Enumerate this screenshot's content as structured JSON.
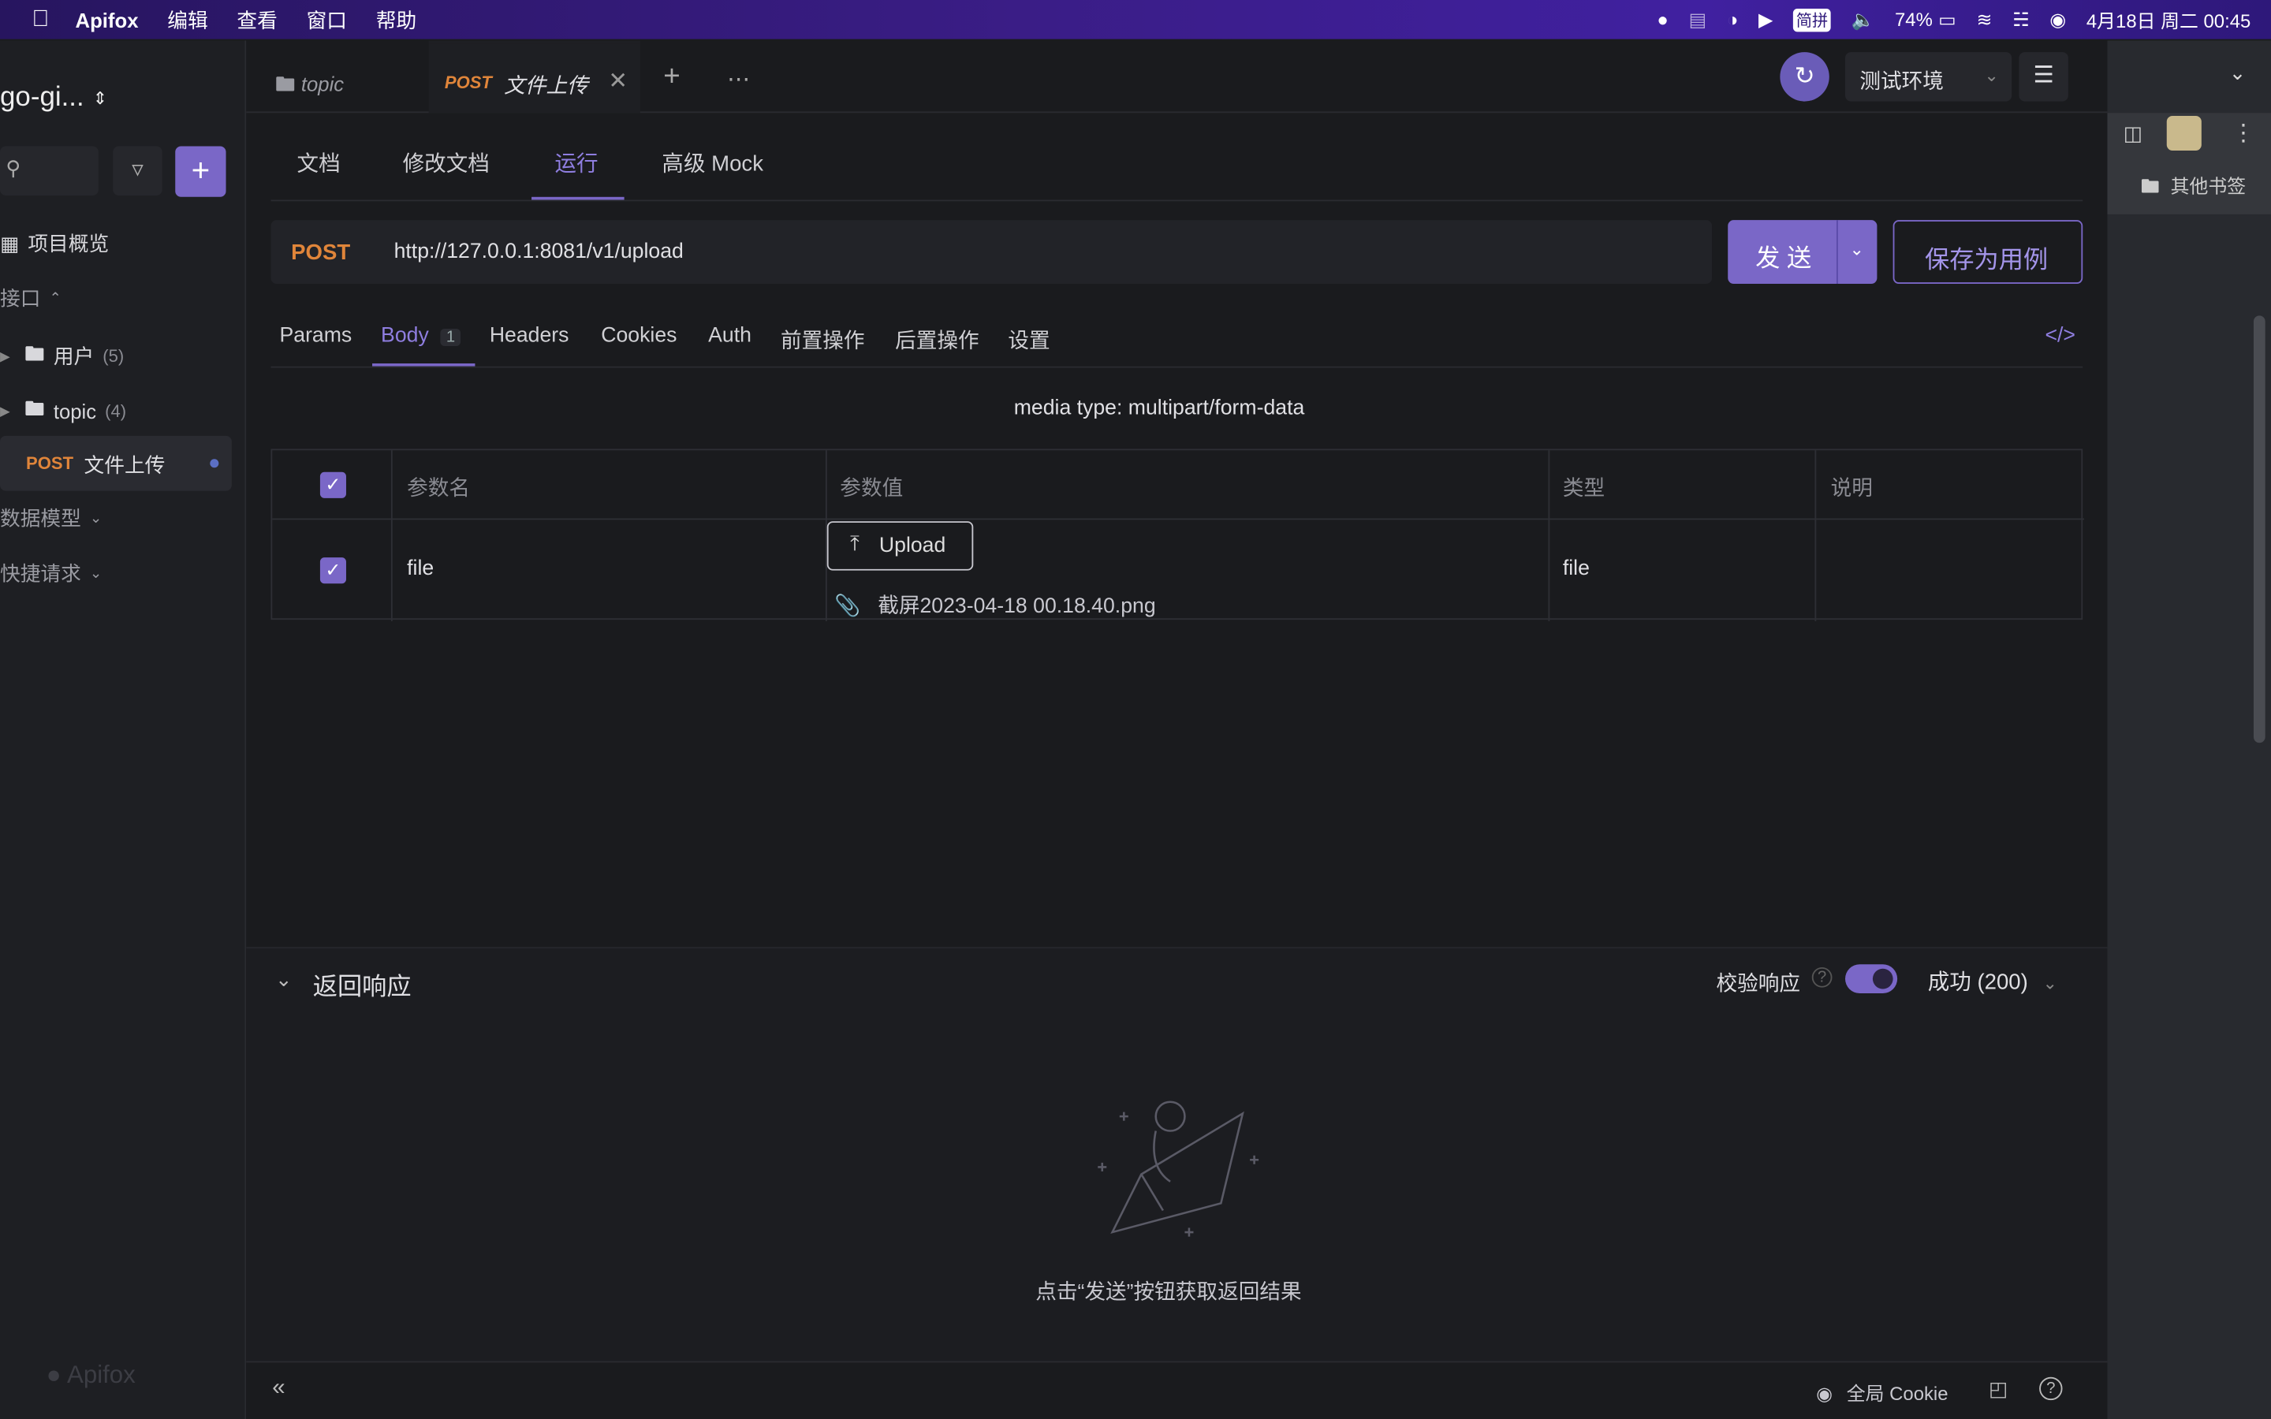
{
  "menubar": {
    "apple": "",
    "app": "Apifox",
    "items": [
      "编辑",
      "查看",
      "窗口",
      "帮助"
    ],
    "tray": {
      "ime": "简拼",
      "battery": "74%",
      "datetime": "4月18日 周二 00:45"
    }
  },
  "sidebar": {
    "project": "go-gi...",
    "overview": "项目概览",
    "interfaces": "接口",
    "folder_users": "用户",
    "folder_users_count": "(5)",
    "folder_topic": "topic",
    "folder_topic_count": "(4)",
    "active_method": "POST",
    "active_label": "文件上传",
    "data_model": "数据模型",
    "quick_request": "快捷请求",
    "watermark": "Apifox"
  },
  "tabs": {
    "tab1": "topic",
    "tab2_method": "POST",
    "tab2_label": "文件上传",
    "env": "测试环境"
  },
  "subtabs": [
    "文档",
    "修改文档",
    "运行",
    "高级 Mock"
  ],
  "request": {
    "method": "POST",
    "url": "http://127.0.0.1:8081/v1/upload",
    "send": "发 送",
    "save": "保存为用例"
  },
  "param_tabs": {
    "params": "Params",
    "body": "Body",
    "body_count": "1",
    "headers": "Headers",
    "cookies": "Cookies",
    "auth": "Auth",
    "pre": "前置操作",
    "post": "后置操作",
    "settings": "设置"
  },
  "body": {
    "media_type": "media type: multipart/form-data",
    "headers": {
      "name": "参数名",
      "value": "参数值",
      "type": "类型",
      "desc": "说明"
    },
    "row": {
      "name": "file",
      "upload": "Upload",
      "filename": "截屏2023-04-18 00.18.40.png",
      "type": "file",
      "desc": ""
    }
  },
  "response": {
    "title": "返回响应",
    "validate": "校验响应",
    "status": "成功 (200)",
    "empty_hint": "点击“发送”按钮获取返回结果"
  },
  "footer": {
    "cookie": "全局 Cookie"
  },
  "browser": {
    "bookmarks": "其他书签"
  },
  "colors": {
    "accent": "#7a67c7",
    "post": "#e0853a",
    "bg": "#1a1b1e"
  }
}
